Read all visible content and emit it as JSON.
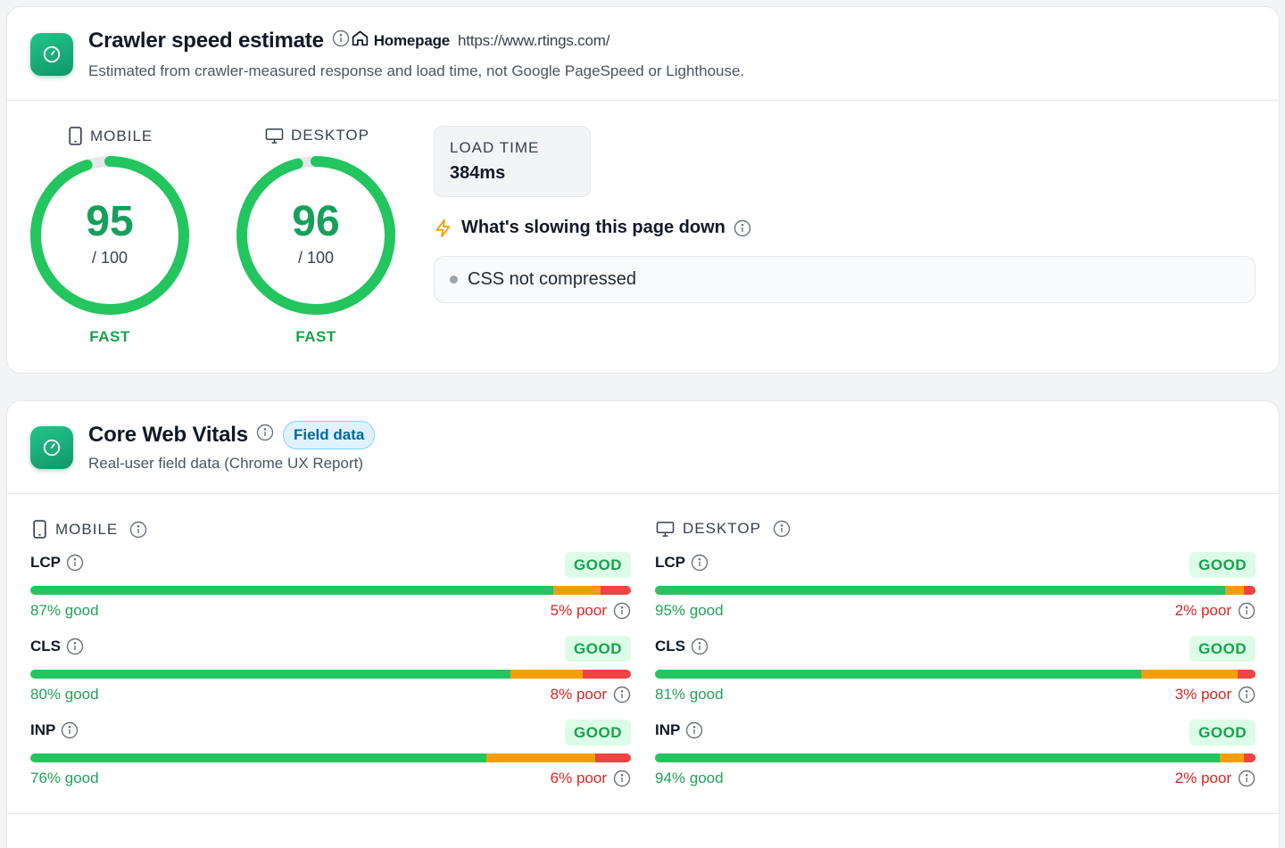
{
  "speed": {
    "title": "Crawler speed estimate",
    "page_label": "Homepage",
    "url": "https://www.rtings.com/",
    "subtitle": "Estimated from crawler-measured response and load time, not Google PageSpeed or Lighthouse.",
    "mobile": {
      "label": "MOBILE",
      "score": "95",
      "max": "/ 100",
      "status": "FAST",
      "score_value": 95
    },
    "desktop": {
      "label": "DESKTOP",
      "score": "96",
      "max": "/ 100",
      "status": "FAST",
      "score_value": 96
    },
    "load_time": {
      "label": "LOAD TIME",
      "value": "384ms"
    },
    "slow_title": "What's slowing this page down",
    "issues": [
      "CSS not compressed"
    ]
  },
  "cwv": {
    "title": "Core Web Vitals",
    "badge": "Field data",
    "subtitle": "Real-user field data (Chrome UX Report)",
    "mobile": {
      "label": "MOBILE",
      "metrics": [
        {
          "name": "LCP",
          "status": "GOOD",
          "good_pct": 87,
          "poor_pct": 5,
          "good_text": "87% good",
          "poor_text": "5% poor"
        },
        {
          "name": "CLS",
          "status": "GOOD",
          "good_pct": 80,
          "poor_pct": 8,
          "good_text": "80% good",
          "poor_text": "8% poor"
        },
        {
          "name": "INP",
          "status": "GOOD",
          "good_pct": 76,
          "poor_pct": 6,
          "good_text": "76% good",
          "poor_text": "6% poor"
        }
      ]
    },
    "desktop": {
      "label": "DESKTOP",
      "metrics": [
        {
          "name": "LCP",
          "status": "GOOD",
          "good_pct": 95,
          "poor_pct": 2,
          "good_text": "95% good",
          "poor_text": "2% poor"
        },
        {
          "name": "CLS",
          "status": "GOOD",
          "good_pct": 81,
          "poor_pct": 3,
          "good_text": "81% good",
          "poor_text": "3% poor"
        },
        {
          "name": "INP",
          "status": "GOOD",
          "good_pct": 94,
          "poor_pct": 2,
          "good_text": "94% good",
          "poor_text": "2% poor"
        }
      ]
    }
  },
  "colors": {
    "good": "#22c55e",
    "needs_improvement": "#f59e0b",
    "poor": "#ef4444",
    "accent": "#12966a",
    "badge_bg": "#e0f2fe"
  }
}
